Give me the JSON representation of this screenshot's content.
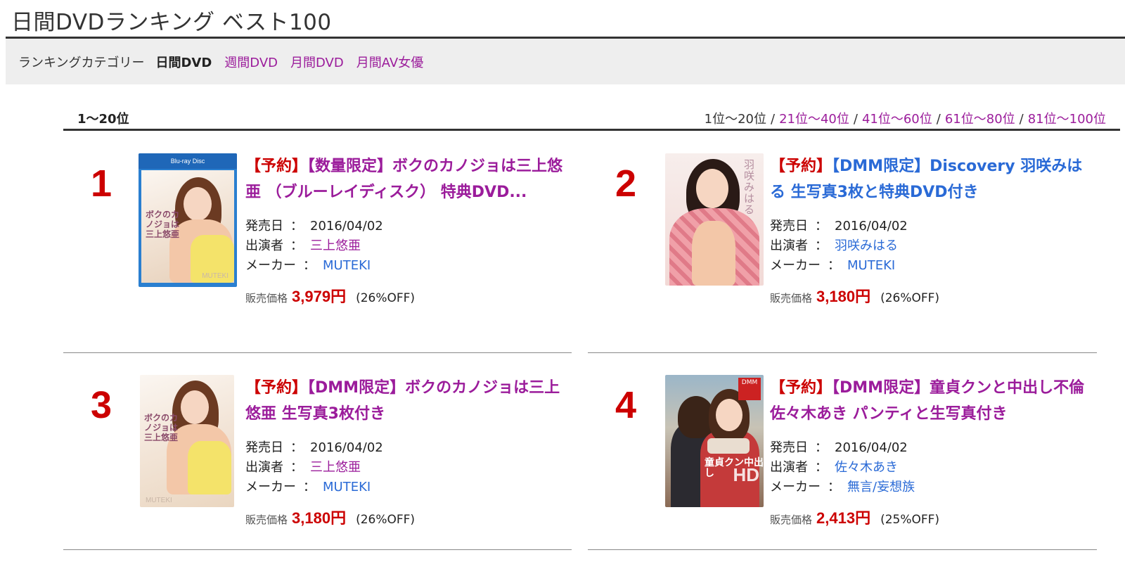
{
  "page": {
    "title": "日間DVDランキング ベスト100"
  },
  "category_bar": {
    "label": "ランキングカテゴリー",
    "current": "日間DVD",
    "links": [
      "週間DVD",
      "月間DVD",
      "月間AV女優"
    ]
  },
  "range": {
    "current": "1〜20位",
    "pager_current": "1位〜20位",
    "pager_links": [
      "21位〜40位",
      "41位〜60位",
      "61位〜80位",
      "81位〜100位"
    ],
    "separator": "/"
  },
  "labels": {
    "release_date": "発売日",
    "performer": "出演者",
    "maker": "メーカー",
    "colon": "：",
    "price": "販売価格"
  },
  "items": [
    {
      "rank": "1",
      "flag": "【予約】",
      "title": "【数量限定】ボクのカノジョは三上悠亜 （ブルーレイディスク） 特典DVD...",
      "release_date": "2016/04/02",
      "performer": "三上悠亜",
      "maker": "MUTEKI",
      "price": "3,979円",
      "discount": "(26%OFF)",
      "jacket_text": "ボクのカノジョは三上悠亜",
      "jacket_badge": "Blu-ray Disc",
      "jacket_brand": "MUTEKI"
    },
    {
      "rank": "2",
      "flag": "【予約】",
      "title": "【DMM限定】Discovery 羽咲みはる 生写真3枚と特典DVD付き",
      "release_date": "2016/04/02",
      "performer": "羽咲みはる",
      "maker": "MUTEKI",
      "price": "3,180円",
      "discount": "(26%OFF)",
      "jacket_text": "羽咲みはる"
    },
    {
      "rank": "3",
      "flag": "【予約】",
      "title": "【DMM限定】ボクのカノジョは三上悠亜 生写真3枚付き",
      "release_date": "2016/04/02",
      "performer": "三上悠亜",
      "maker": "MUTEKI",
      "price": "3,180円",
      "discount": "(26%OFF)",
      "jacket_text": "ボクのカノジョは三上悠亜",
      "jacket_brand": "MUTEKI"
    },
    {
      "rank": "4",
      "flag": "【予約】",
      "title": "【DMM限定】童貞クンと中出し不倫 佐々木あき パンティと生写真付き",
      "release_date": "2016/04/02",
      "performer": "佐々木あき",
      "maker": "無言/妄想族",
      "price": "2,413円",
      "discount": "(25%OFF)",
      "jacket_text": "童貞クン中出し",
      "jacket_tag": "HD",
      "jacket_badge": "DMM"
    }
  ],
  "colors": {
    "link_purple": "#9b1c9b",
    "link_blue": "#2a6ad6",
    "price_red": "#cc0000",
    "category_bg": "#eeeeee"
  }
}
